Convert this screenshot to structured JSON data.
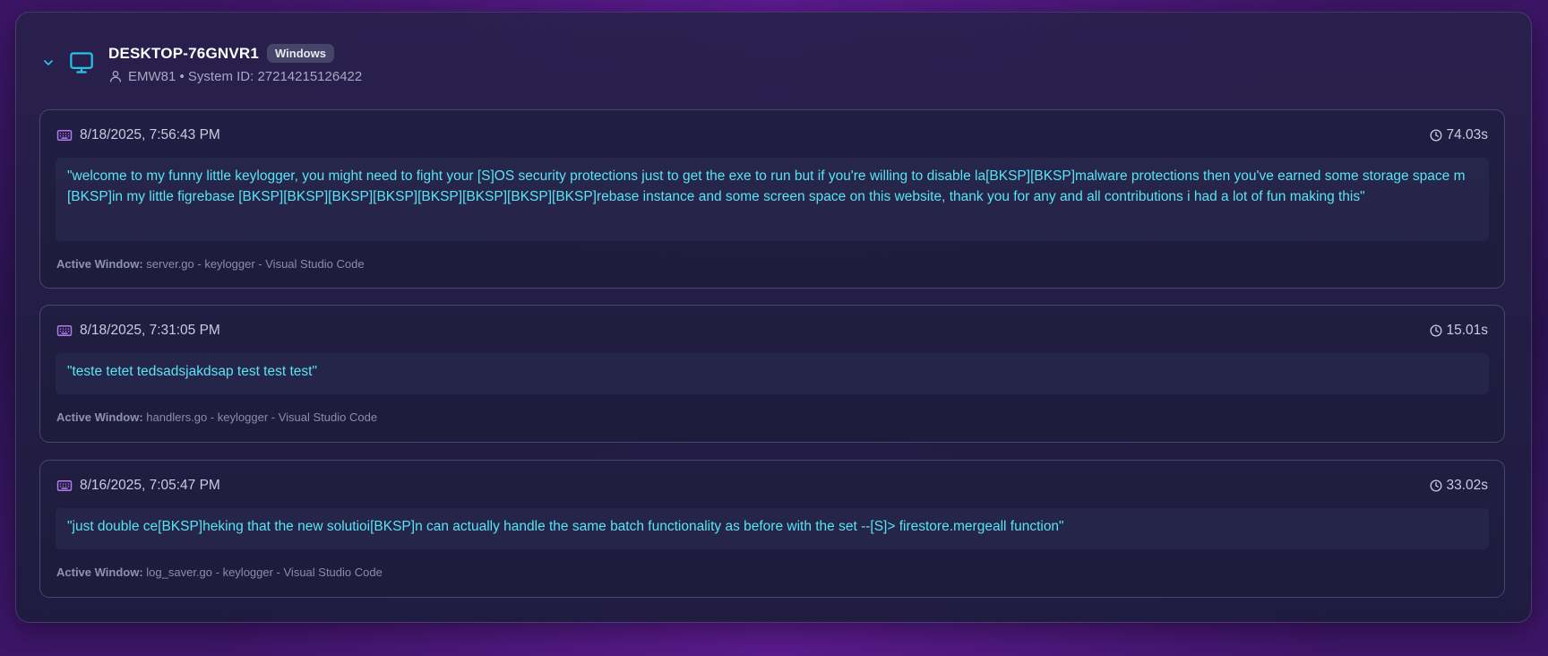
{
  "device": {
    "hostname": "DESKTOP-76GNVR1",
    "os": "Windows",
    "subtitle": "EMW81 • System ID: 27214215126422"
  },
  "logs": [
    {
      "timestamp": "8/18/2025, 7:56:43 PM",
      "duration": "74.03s",
      "content": "\"welcome to my funny little keylogger, you might need to fight your [S]OS security protections just to get the exe to run but if you're willing to disable la[BKSP][BKSP]malware protections then you've earned some storage space m[BKSP]in my little figrebase [BKSP][BKSP][BKSP][BKSP][BKSP][BKSP][BKSP][BKSP]rebase instance and some screen space on this website, thank you for any and all contributions i had a lot of fun making this\"",
      "window_label": "Active Window:",
      "window": "server.go - keylogger - Visual Studio Code"
    },
    {
      "timestamp": "8/18/2025, 7:31:05 PM",
      "duration": "15.01s",
      "content": "\"teste tetet tedsadsjakdsap test test test\"",
      "window_label": "Active Window:",
      "window": "handlers.go - keylogger - Visual Studio Code"
    },
    {
      "timestamp": "8/16/2025, 7:05:47 PM",
      "duration": "33.02s",
      "content": "\"just double ce[BKSP]heking that the new solutioi[BKSP]n can actually handle the same batch functionality as before with the set --[S]> firestore.mergeall function\"",
      "window_label": "Active Window:",
      "window": "log_saver.go - keylogger - Visual Studio Code"
    }
  ],
  "icons": {
    "chevron": "chevron-down-icon",
    "monitor": "monitor-icon",
    "user": "user-icon",
    "keyboard": "keyboard-icon",
    "clock": "clock-icon"
  },
  "colors": {
    "accent_cyan": "#59e3f5",
    "monitor_icon": "#22c4e8",
    "keyboard_icon": "#b47cf0"
  }
}
